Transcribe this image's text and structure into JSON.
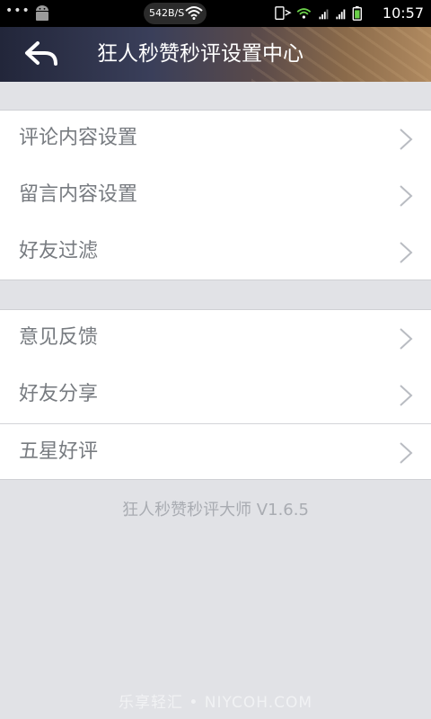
{
  "status_bar": {
    "menu_dots": "•••",
    "net_speed": "542B/S",
    "time": "10:57",
    "icons": [
      "android-icon",
      "wifi-icon",
      "sim-icon",
      "signal-icon",
      "signal-icon",
      "battery-icon"
    ]
  },
  "header": {
    "back_icon": "back-arrow-icon",
    "title": "狂人秒赞秒评设置中心"
  },
  "menu_group_1": [
    {
      "label": "评论内容设置"
    },
    {
      "label": "留言内容设置"
    },
    {
      "label": "好友过滤"
    }
  ],
  "menu_group_2": [
    {
      "label": "意见反馈"
    },
    {
      "label": "好友分享"
    },
    {
      "label": "五星好评"
    }
  ],
  "footer": {
    "version": "狂人秒赞秒评大师 V1.6.5",
    "watermark": "乐享轻汇 • NIYCOH.COM"
  },
  "colors": {
    "background": "#e1e2e6",
    "row_text": "#777b80",
    "chevron": "#b9bcc2",
    "version_text": "#a9acb2"
  }
}
